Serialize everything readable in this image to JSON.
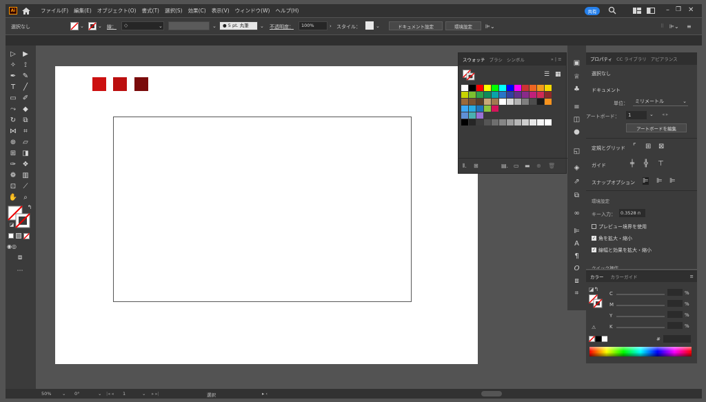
{
  "menubar": {
    "app_icon": "Ai",
    "home_icon": "home-icon",
    "items": [
      "ファイル(F)",
      "編集(E)",
      "オブジェクト(O)",
      "書式(T)",
      "選択(S)",
      "効果(C)",
      "表示(V)",
      "ウィンドウ(W)",
      "ヘルプ(H)"
    ],
    "share_label": "共有",
    "search_icon": "search-icon",
    "window_controls": [
      "minimize-icon",
      "restore-icon",
      "close-icon"
    ]
  },
  "controlbar": {
    "selection_label": "選択なし",
    "stroke_label": "線：",
    "brush_label": "5 pt. 丸筆",
    "opacity_label": "不透明度：",
    "opacity_value": "100%",
    "style_label": "スタイル：",
    "doc_settings_button": "ドキュメント設定",
    "prefs_button": "環境設定"
  },
  "artboard": {
    "swatch_colors": [
      "#cc1010",
      "#bb0f0f",
      "#7a0b0b"
    ]
  },
  "swatches_panel": {
    "tabs": [
      "スウォッチ",
      "ブラシ",
      "シンボル"
    ],
    "active_tab": "スウォッチ",
    "colors_row1": [
      "#ffffff",
      "#000000",
      "#ff0000",
      "#ffff00",
      "#00ff00",
      "#00ffff",
      "#0000ff",
      "#ff00ff",
      "#cc3333",
      "#ee6622",
      "#f39a1b",
      "#f5d800"
    ],
    "colors_row2": [
      "#c8d400",
      "#7dbf2f",
      "#2ea04a",
      "#0e8a5a",
      "#0aa3a8",
      "#2a74c8",
      "#3340a0",
      "#61308a",
      "#8a2a8a",
      "#c0207a",
      "#d02a55",
      "#8b2a2a"
    ],
    "colors_row3": [
      "#9b6a3a",
      "#7a5232",
      "#5a3d28",
      "#c8a878",
      "#a07a50",
      "#ffffff",
      "#d9d9d9",
      "#b3b3b3",
      "#808080",
      "#4d4d4d",
      "#1a1a1a",
      "#f7931e"
    ],
    "colors_row4": [
      "#3fa9f5",
      "#29abe2",
      "#1c75bc",
      "#8cc63f",
      "#d4145a"
    ],
    "colors_row5": [
      "#5f90d6",
      "#4ab0b0",
      "#9a70d6"
    ],
    "colors_row6": [
      "#000000",
      "#262626",
      "#3d3d3d",
      "#555555",
      "#6e6e6e",
      "#868686",
      "#9e9e9e",
      "#b7b7b7",
      "#cfcfcf",
      "#e7e7e7",
      "#f5f5f5",
      "#ffffff"
    ]
  },
  "properties_panel": {
    "tabs": [
      "プロパティ",
      "CC ライブラリ",
      "アピアランス"
    ],
    "active_tab": "プロパティ",
    "selection": "選択なし",
    "document_heading": "ドキュメント",
    "unit_label": "単位：",
    "unit_value": "ミリメートル",
    "artboard_label": "アートボード：",
    "artboard_value": "1",
    "edit_artboard_button": "アートボードを編集",
    "rulers_grid_label": "定規とグリッド",
    "guides_label": "ガイド",
    "snap_label": "スナップオプション",
    "prefs_heading": "環境設定",
    "key_increment_label": "キー入力：",
    "key_increment_value": "0.3528 п",
    "preview_bounds_label": "プレビュー境界を使用",
    "scale_corners_label": "角を拡大・縮小",
    "scale_strokes_label": "線幅と効果を拡大・縮小",
    "cut_label": "クイック操作"
  },
  "color_panel": {
    "tabs": [
      "カラー",
      "カラーガイド"
    ],
    "active_tab": "カラー",
    "channels": [
      "C",
      "M",
      "Y",
      "K"
    ],
    "percent": "%",
    "hex_prefix": "#"
  },
  "statusbar": {
    "zoom": "50%",
    "rotation": "0°",
    "artboard_nav": "1",
    "tool_label": "選択"
  }
}
